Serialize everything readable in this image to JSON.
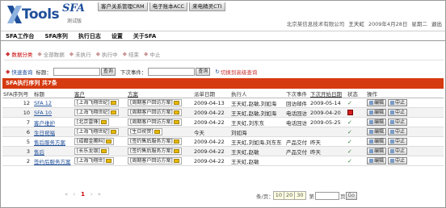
{
  "header": {
    "logo_text": "Tools",
    "logo_sfa": "SFA",
    "logo_sub": "测试版",
    "top_tabs": [
      "客户关系管理CRM",
      "电子账本ACC",
      "来电精灵CTI"
    ],
    "company": "北京某信息技术有限公司",
    "user": "王天虹",
    "date": "2009年4月28日",
    "weekday": "星期二",
    "logout": "退出"
  },
  "menu": [
    "SFA工作台",
    "SFA序列",
    "执行日志",
    "设置",
    "关于SFA"
  ],
  "tabs": {
    "active": "数据分类",
    "items": [
      "全部数据",
      "未执行",
      "执行中",
      "结束",
      "中止"
    ]
  },
  "search": {
    "quick_label": "快速查询",
    "title_label": "标题：",
    "title_value": "",
    "query_btn": "查询",
    "next_label": "下次事件：",
    "next_value": "",
    "query_btn2": "查询",
    "advanced": "切换到高级查询"
  },
  "list": {
    "title": "SFA执行序列  共7条",
    "columns": [
      "SFA序列号",
      "标题",
      "客户",
      "方案",
      "派单日期",
      "执行人",
      "下次事件",
      "下次开始日期",
      "状态",
      "操作"
    ],
    "rows": [
      {
        "idx": "12",
        "title": "SFA 12",
        "customer": "上海飞翔世纪",
        "plan": "周期客户回访方案",
        "date": "2009-04-13",
        "executor": "王天虹,赵敏,刘如海",
        "next_event": "回访邮件",
        "next_date": "2009-05-14",
        "status": "ok",
        "ops": [
          "编辑",
          "中止"
        ]
      },
      {
        "idx": "10",
        "title": "SFA 10",
        "customer": "上海飞翔世纪",
        "plan": "周期客户回访方案",
        "date": "2009-04-22",
        "executor": "王天虹,赵敏,刘如海",
        "next_event": "电话回访",
        "next_date": "2009-04-20",
        "status": "red",
        "ops": [
          "编辑",
          "中止"
        ]
      },
      {
        "idx": "7",
        "title": "客户维护",
        "customer": "北京雷锋",
        "plan": "周期客户回访方案",
        "date": "2009-04-22",
        "executor": "王天虹,刘东东",
        "next_event": "电话回访",
        "next_date": "2009-05-25",
        "status": "ok",
        "ops": [
          "编辑",
          "中止"
        ]
      },
      {
        "idx": "6",
        "title": "生日祝福",
        "customer": "上海飞翔世纪",
        "plan": "生日祝贺",
        "date": "今天",
        "executor": "刘如海",
        "next_event": "",
        "next_date": "",
        "status": "ok",
        "ops": [
          "编辑",
          "中止"
        ]
      },
      {
        "idx": "5",
        "title": "售后服务方案",
        "customer": "成都金腾科",
        "plan": "签约售后服务方案",
        "date": "2009-04-22",
        "executor": "王天虹,刘如海,刘东东",
        "next_event": "产品交付",
        "next_date": "昨天",
        "status": "ok",
        "ops": [
          "编辑",
          "中止"
        ]
      },
      {
        "idx": "3",
        "title": "售后",
        "customer": "长乐龙银",
        "plan": "签约售后服务方案",
        "date": "2009-04-22",
        "executor": "王天虹,赵敏",
        "next_event": "产品交付",
        "next_date": "昨天",
        "status": "ok",
        "ops": [
          "编辑",
          "中止"
        ]
      },
      {
        "idx": "2",
        "title": "签约后服务方案",
        "customer": "上海飞翔世",
        "plan": "周期客户回访方案",
        "date": "2009-04-22",
        "executor": "王天虹,赵敏",
        "next_event": "",
        "next_date": "",
        "status": "ok",
        "ops": [
          "编辑",
          "中止"
        ]
      }
    ]
  },
  "pager": {
    "current": "1",
    "pagesize_label": "条/页：",
    "sizes": [
      "10",
      "20",
      "30"
    ],
    "page_label_pre": "第",
    "page_label_post": "页",
    "go": "Go"
  },
  "colors": {
    "accent_bar": "#d53a10",
    "link": "#1f4f9a",
    "active_tab": "#c60000"
  }
}
